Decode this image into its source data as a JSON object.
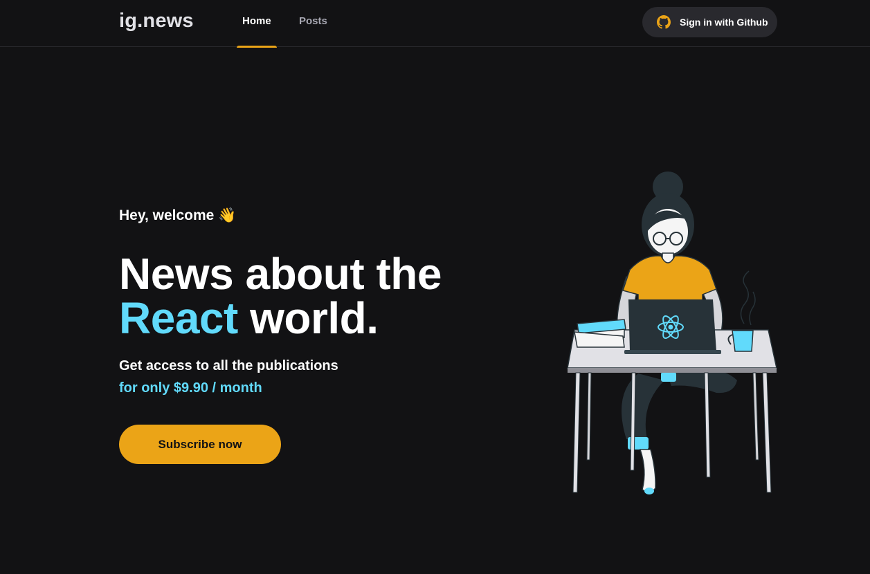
{
  "header": {
    "logo": "ig.news",
    "nav": [
      {
        "label": "Home",
        "active": true
      },
      {
        "label": "Posts",
        "active": false
      }
    ],
    "signin_label": "Sign in with Github",
    "signin_icon": "github-icon"
  },
  "hero": {
    "welcome": "Hey, welcome",
    "welcome_emoji": "👋",
    "title_line1": "News about the",
    "title_accent": "React",
    "title_line2_rest": " world.",
    "access_text": "Get access to all the publications",
    "price_text": "for only $9.90 / month",
    "subscribe_label": "Subscribe now"
  },
  "colors": {
    "background": "#121214",
    "accent_yellow": "#eba417",
    "accent_cyan": "#61dafb",
    "button_dark": "#29292e"
  }
}
